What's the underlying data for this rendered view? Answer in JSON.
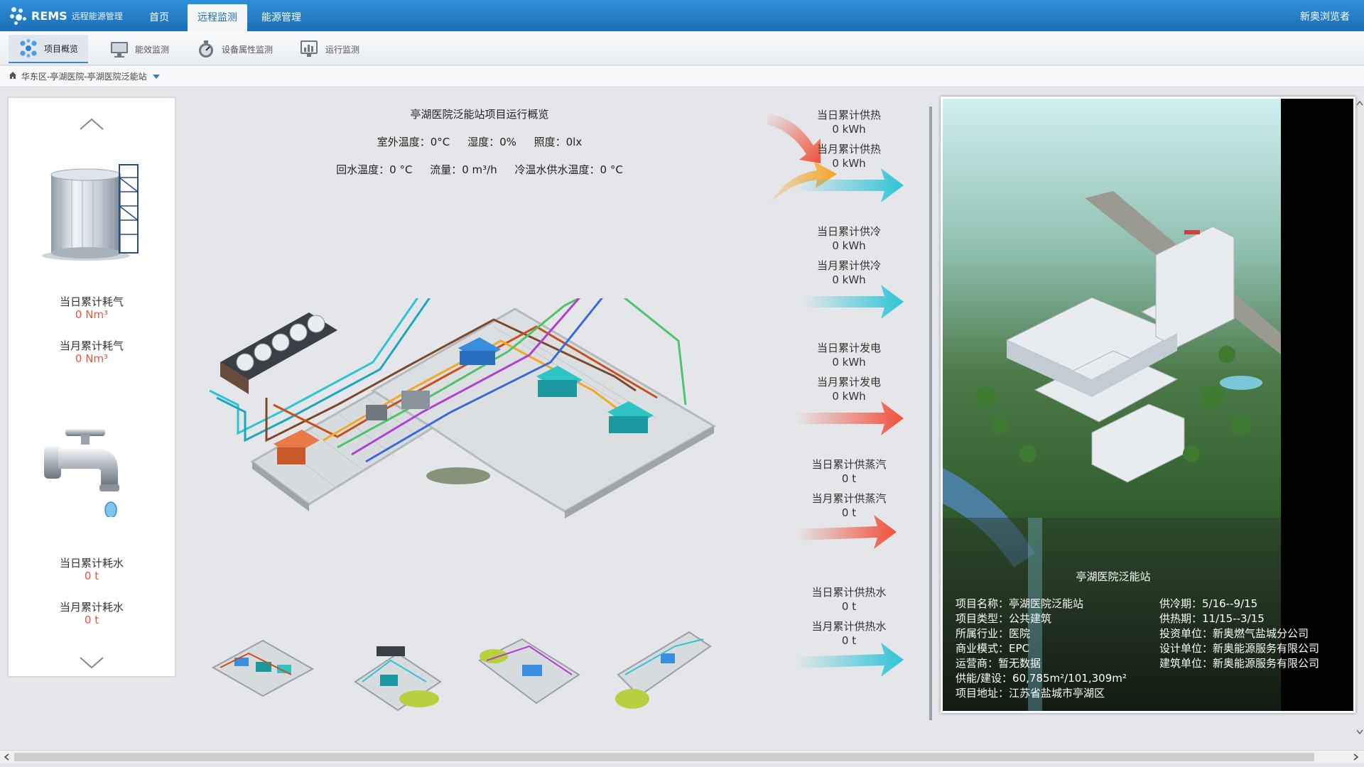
{
  "app": {
    "logo_text": "REMS",
    "logo_sub": "远程能源管理",
    "user_label": "新奥浏览者"
  },
  "nav": {
    "tabs": [
      {
        "label": "首页"
      },
      {
        "label": "远程监测"
      },
      {
        "label": "能源管理"
      }
    ]
  },
  "subnav": {
    "tabs": [
      {
        "label": "项目概览",
        "icon": "molecule-icon"
      },
      {
        "label": "能效监测",
        "icon": "monitor-icon"
      },
      {
        "label": "设备属性监测",
        "icon": "gauge-icon"
      },
      {
        "label": "运行监测",
        "icon": "chart-screen-icon"
      }
    ]
  },
  "breadcrumb": {
    "text": "华东区-亭湖医院-亭湖医院泛能站"
  },
  "left_panel": {
    "gas": {
      "day_label": "当日累计耗气",
      "day_value": "0 Nm³",
      "month_label": "当月累计耗气",
      "month_value": "0 Nm³"
    },
    "water": {
      "day_label": "当日累计耗水",
      "day_value": "0 t",
      "month_label": "当月累计耗水",
      "month_value": "0 t"
    }
  },
  "center": {
    "title": "亭湖医院泛能站项目运行概览",
    "row1": [
      "室外温度：0°C",
      "湿度：0%",
      "照度：0lx"
    ],
    "row2": [
      "回水温度：0 °C",
      "流量：0 m³/h",
      "冷温水供水温度：0 °C"
    ]
  },
  "flows": [
    {
      "day_label": "当日累计供热",
      "day_value": "0 kWh",
      "month_label": "当月累计供热",
      "month_value": "0 kWh"
    },
    {
      "day_label": "当日累计供冷",
      "day_value": "0 kWh",
      "month_label": "当月累计供冷",
      "month_value": "0 kWh"
    },
    {
      "day_label": "当日累计发电",
      "day_value": "0 kWh",
      "month_label": "当月累计发电",
      "month_value": "0 kWh"
    },
    {
      "day_label": "当日累计供蒸汽",
      "day_value": "0 t",
      "month_label": "当月累计供蒸汽",
      "month_value": "0 t"
    },
    {
      "day_label": "当日累计供热水",
      "day_value": "0 t",
      "month_label": "当月累计供热水",
      "month_value": "0 t"
    }
  ],
  "project": {
    "station_name": "亭湖医院泛能站",
    "left_items": [
      "项目名称：亭湖医院泛能站",
      "项目类型：公共建筑",
      "所属行业：医院",
      "商业模式：EPC",
      "运营商：暂无数据",
      "供能/建设：60,785m²/101,309m²",
      "项目地址：江苏省盐城市亭湖区"
    ],
    "right_items": [
      "供冷期：5/16--9/15",
      "供热期：11/15--3/15",
      "投资单位：新奥燃气盐城分公司",
      "设计单位：新奥能源服务有限公司",
      "建筑单位：新奥能源服务有限公司"
    ]
  },
  "colors": {
    "nav_blue": "#1c6fb8",
    "value_red": "#e8553a",
    "arrow_teal": "#2ec4d6",
    "arrow_red": "#f0503a",
    "arrow_orange": "#f5a623"
  }
}
